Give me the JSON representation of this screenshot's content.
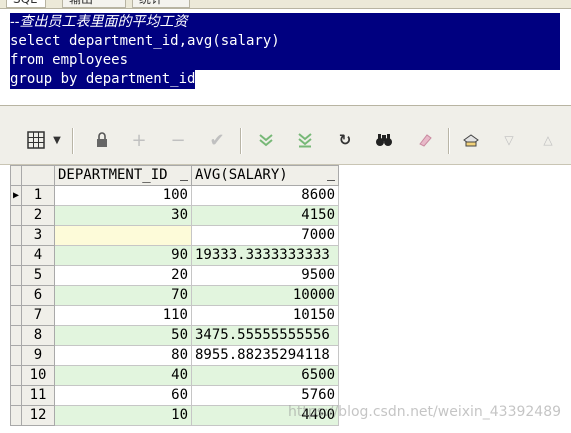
{
  "tabs": [
    "SQL",
    "输出",
    "统计"
  ],
  "editor": {
    "lines": [
      "--查出员工表里面的平均工资",
      "select department_id,avg(salary)",
      "from employees",
      "group by department_id"
    ]
  },
  "toolbar": {
    "buttons": [
      "grid-view-icon",
      "dropdown-icon",
      "lock-icon",
      "add-icon",
      "remove-icon",
      "check-icon",
      "fetch-next-icon",
      "fetch-all-icon",
      "refresh-icon",
      "find-icon",
      "clear-icon",
      "export-icon",
      "filter-down-icon",
      "filter-up-icon"
    ]
  },
  "grid": {
    "columns": [
      "DEPARTMENT_ID",
      "AVG(SALARY)"
    ],
    "rows": [
      {
        "num": "1",
        "department_id": "100",
        "avg_salary": "8600"
      },
      {
        "num": "2",
        "department_id": "30",
        "avg_salary": "4150"
      },
      {
        "num": "3",
        "department_id": "",
        "avg_salary": "7000"
      },
      {
        "num": "4",
        "department_id": "90",
        "avg_salary": "19333.3333333333"
      },
      {
        "num": "5",
        "department_id": "20",
        "avg_salary": "9500"
      },
      {
        "num": "6",
        "department_id": "70",
        "avg_salary": "10000"
      },
      {
        "num": "7",
        "department_id": "110",
        "avg_salary": "10150"
      },
      {
        "num": "8",
        "department_id": "50",
        "avg_salary": "3475.55555555556"
      },
      {
        "num": "9",
        "department_id": "80",
        "avg_salary": "8955.88235294118"
      },
      {
        "num": "10",
        "department_id": "40",
        "avg_salary": "6500"
      },
      {
        "num": "11",
        "department_id": "60",
        "avg_salary": "5760"
      },
      {
        "num": "12",
        "department_id": "10",
        "avg_salary": "4400"
      }
    ]
  },
  "watermark": "https://blog.csdn.net/weixin_43392489"
}
